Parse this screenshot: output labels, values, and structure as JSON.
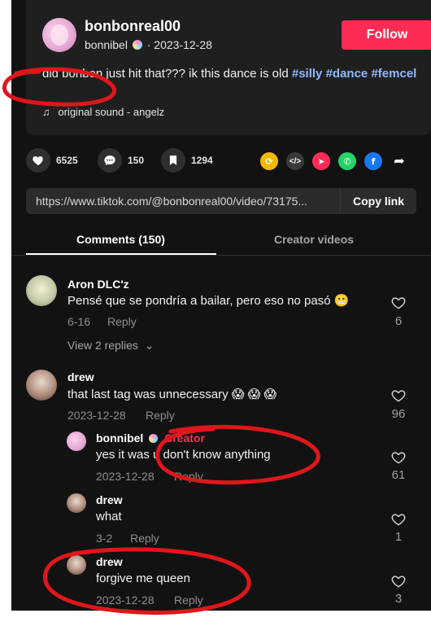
{
  "post": {
    "username": "bonbonreal00",
    "nickname": "bonnibel",
    "date": "2023-12-28",
    "follow_label": "Follow",
    "description": "did bonbon just hit that??? ik this dance is old",
    "tags": [
      "#silly",
      "#dance",
      "#femcel"
    ],
    "sound": "original sound - angelz"
  },
  "stats": {
    "likes": "6525",
    "comments": "150",
    "saves": "1294"
  },
  "share_icons": [
    {
      "name": "repost-icon",
      "color": "#f5b800"
    },
    {
      "name": "embed-icon",
      "color": "#3a3a3a"
    },
    {
      "name": "send-icon",
      "color": "#fe2c55"
    },
    {
      "name": "whatsapp-icon",
      "color": "#25d366"
    },
    {
      "name": "facebook-icon",
      "color": "#1877f2"
    },
    {
      "name": "share-arrow-icon",
      "color": "#ffffff"
    }
  ],
  "link": {
    "url": "https://www.tiktok.com/@bonbonreal00/video/73175...",
    "copy_label": "Copy link"
  },
  "tabs": {
    "comments": "Comments (150)",
    "creator": "Creator videos"
  },
  "comments": [
    {
      "user": "Aron DLC'z",
      "text": "Pensé que se pondría a bailar, pero eso no pasó 😬",
      "date": "6-16",
      "reply": "Reply",
      "likes": "6",
      "view_replies": "View 2 replies"
    },
    {
      "user": "drew",
      "text": "that last tag was unnecessary 😱 😱 😱",
      "date": "2023-12-28",
      "reply": "Reply",
      "likes": "96",
      "replies": [
        {
          "user": "bonnibel",
          "badge": "Creator",
          "text": "yes it was u don't know anything",
          "date": "2023-12-28",
          "reply": "Reply",
          "likes": "61"
        },
        {
          "user": "drew",
          "text": "what",
          "date": "3-2",
          "reply": "Reply",
          "likes": "1"
        },
        {
          "user": "drew",
          "text": "forgive me queen",
          "date": "2023-12-28",
          "reply": "Reply",
          "likes": "3"
        }
      ]
    }
  ],
  "annotation_color": "#e0161c"
}
